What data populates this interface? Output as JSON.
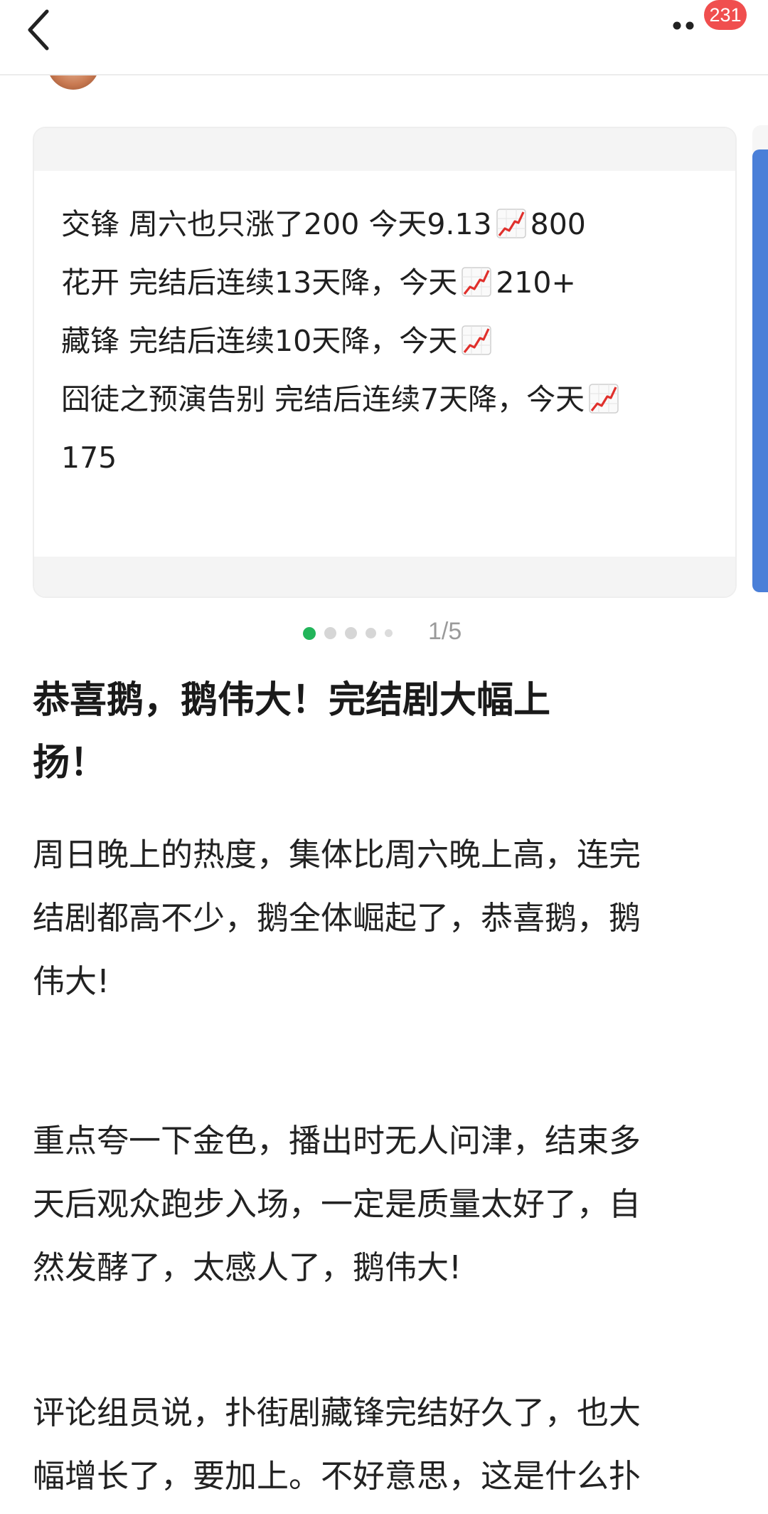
{
  "topbar": {
    "back_icon": "chevron-left-icon",
    "more_icon": "more-dots-icon",
    "badge_count": "231"
  },
  "carousel": {
    "lines": [
      {
        "text": "交锋 周六也只涨了200 今天9.13",
        "suffix": "800",
        "icon": true
      },
      {
        "text": "花开 完结后连续13天降，今天",
        "suffix": "210+",
        "icon": true
      },
      {
        "text": "藏锋 完结后连续10天降，今天",
        "suffix": "",
        "icon": true
      },
      {
        "text": "囧徒之预演告别 完结后连续7天降，今天",
        "suffix": "",
        "icon": true
      },
      {
        "text": "175",
        "suffix": "",
        "icon": false
      }
    ],
    "pager_text": "1/5",
    "active_index": 0,
    "total": 5,
    "colors": {
      "active_dot": "#22b55a",
      "inactive_dot": "#d6d6d6",
      "chart_line": "#e0302c"
    }
  },
  "post": {
    "title_line1": "恭喜鹅，鹅伟大！完结剧大幅上",
    "title_line2": "扬！",
    "paragraphs": [
      [
        "周日晚上的热度，集体比周六晚上高，连完",
        "结剧都高不少，鹅全体崛起了，恭喜鹅，鹅",
        "伟大!"
      ],
      [
        "重点夸一下金色，播出时无人问津，结束多",
        "天后观众跑步入场，一定是质量太好了，自",
        "然发酵了，太感人了，鹅伟大!"
      ],
      [
        "评论组员说，扑街剧藏锋完结好久了，也大",
        "幅增长了，要加上。不好意思，这是什么扑"
      ]
    ]
  }
}
